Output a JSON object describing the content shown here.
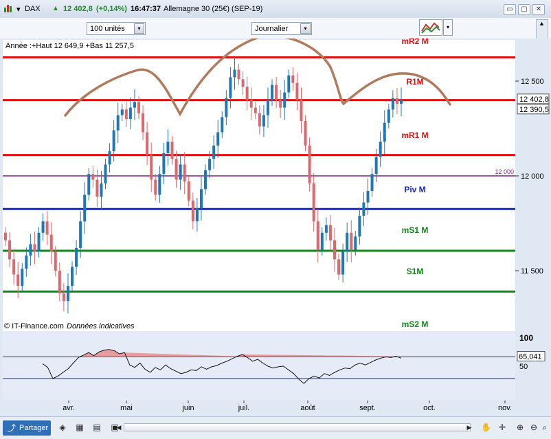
{
  "window": {
    "symbol": "DAX",
    "price": "12 402,8",
    "change": "(+0,14%)",
    "time": "16:47:37",
    "instrument": "Allemagne 30 (25€) (SEP-19)",
    "minimize": "▭",
    "restore": "▢",
    "close": "✕"
  },
  "toolbar": {
    "units_select": "100 unités",
    "period_select": "Journalier",
    "dropdown_arrow": "▾"
  },
  "colors": {
    "up": "#1f77b4",
    "down": "#d9696e",
    "resistance": "#e01010",
    "pivot": "#1428c8",
    "support": "#0a8a14",
    "guide": "#7a1e88",
    "drawing": "#b07a5c"
  },
  "footer": {
    "share_label": "Partager",
    "icons": [
      "layers-icon",
      "table-icon",
      "grid-icon",
      "window-icon",
      "clock-icon",
      "scroll-left-icon",
      "scroll-right-icon",
      "hand-icon",
      "zoom-in-icon",
      "zoom-out-icon",
      "search-icon"
    ]
  },
  "chart_data": {
    "type": "candlestick",
    "info_text": "Année :+Haut 12 649,9 +Bas 11 257,5",
    "watermark": "© IT-Finance.com",
    "watermark_note": "Données indicatives",
    "price_axis": {
      "ticks": [
        "12 500",
        "12 000",
        "11 500"
      ],
      "values": [
        12500,
        12000,
        11500
      ],
      "range": [
        11200,
        12800
      ],
      "current_price": "12 402,8",
      "last_close_label": "12 390,5",
      "guide_label": "12 000"
    },
    "x_axis_labels": [
      "avr.",
      "mai",
      "juin",
      "juil.",
      "août",
      "sept.",
      "oct.",
      "nov."
    ],
    "levels": [
      {
        "label": "mR2 M",
        "value": 12800,
        "role": "resistance",
        "drawn": false
      },
      {
        "label": "R1M",
        "value": 12625,
        "role": "resistance",
        "drawn": true
      },
      {
        "label": "mR1 M",
        "value": 12110,
        "role": "resistance",
        "drawn": true
      },
      {
        "label": "Piv M",
        "value": 11825,
        "role": "pivot",
        "drawn": true
      },
      {
        "label": "mS1 M",
        "value": 11605,
        "role": "support",
        "drawn": true
      },
      {
        "label": "S1M",
        "value": 11390,
        "role": "support",
        "drawn": true
      },
      {
        "label": "mS2 M",
        "value": 11180,
        "role": "support",
        "drawn": false
      }
    ],
    "resistance_current": 12400,
    "guide_line": 12000,
    "candles": [
      {
        "o": 11700,
        "c": 11660
      },
      {
        "o": 11660,
        "c": 11560
      },
      {
        "o": 11560,
        "c": 11480
      },
      {
        "o": 11480,
        "c": 11420
      },
      {
        "o": 11420,
        "c": 11510
      },
      {
        "o": 11510,
        "c": 11580
      },
      {
        "o": 11580,
        "c": 11640
      },
      {
        "o": 11640,
        "c": 11600
      },
      {
        "o": 11600,
        "c": 11700
      },
      {
        "o": 11700,
        "c": 11760
      },
      {
        "o": 11760,
        "c": 11690
      },
      {
        "o": 11690,
        "c": 11600
      },
      {
        "o": 11600,
        "c": 11500
      },
      {
        "o": 11500,
        "c": 11380
      },
      {
        "o": 11380,
        "c": 11340
      },
      {
        "o": 11340,
        "c": 11420
      },
      {
        "o": 11420,
        "c": 11520
      },
      {
        "o": 11520,
        "c": 11620
      },
      {
        "o": 11620,
        "c": 11760
      },
      {
        "o": 11760,
        "c": 11900
      },
      {
        "o": 11900,
        "c": 12010
      },
      {
        "o": 12010,
        "c": 11980
      },
      {
        "o": 11980,
        "c": 11890
      },
      {
        "o": 11890,
        "c": 11960
      },
      {
        "o": 11960,
        "c": 12060
      },
      {
        "o": 12060,
        "c": 12130
      },
      {
        "o": 12130,
        "c": 12240
      },
      {
        "o": 12240,
        "c": 12320
      },
      {
        "o": 12320,
        "c": 12350
      },
      {
        "o": 12350,
        "c": 12300
      },
      {
        "o": 12300,
        "c": 12360
      },
      {
        "o": 12360,
        "c": 12390
      },
      {
        "o": 12390,
        "c": 12330
      },
      {
        "o": 12330,
        "c": 12230
      },
      {
        "o": 12230,
        "c": 12110
      },
      {
        "o": 12110,
        "c": 11980
      },
      {
        "o": 11980,
        "c": 11900
      },
      {
        "o": 11900,
        "c": 12010
      },
      {
        "o": 12010,
        "c": 12120
      },
      {
        "o": 12120,
        "c": 12180
      },
      {
        "o": 12180,
        "c": 12090
      },
      {
        "o": 12090,
        "c": 11980
      },
      {
        "o": 11980,
        "c": 12060
      },
      {
        "o": 12060,
        "c": 11970
      },
      {
        "o": 11970,
        "c": 11870
      },
      {
        "o": 11870,
        "c": 11760
      },
      {
        "o": 11760,
        "c": 11830
      },
      {
        "o": 11830,
        "c": 11930
      },
      {
        "o": 11930,
        "c": 12030
      },
      {
        "o": 12030,
        "c": 12090
      },
      {
        "o": 12090,
        "c": 12160
      },
      {
        "o": 12160,
        "c": 12230
      },
      {
        "o": 12230,
        "c": 12310
      },
      {
        "o": 12310,
        "c": 12410
      },
      {
        "o": 12410,
        "c": 12520
      },
      {
        "o": 12520,
        "c": 12560
      },
      {
        "o": 12560,
        "c": 12510
      },
      {
        "o": 12510,
        "c": 12470
      },
      {
        "o": 12470,
        "c": 12400
      },
      {
        "o": 12400,
        "c": 12360
      },
      {
        "o": 12360,
        "c": 12330
      },
      {
        "o": 12330,
        "c": 12260
      },
      {
        "o": 12260,
        "c": 12320
      },
      {
        "o": 12320,
        "c": 12400
      },
      {
        "o": 12400,
        "c": 12480
      },
      {
        "o": 12480,
        "c": 12400
      },
      {
        "o": 12400,
        "c": 12360
      },
      {
        "o": 12360,
        "c": 12440
      },
      {
        "o": 12440,
        "c": 12530
      },
      {
        "o": 12530,
        "c": 12490
      },
      {
        "o": 12490,
        "c": 12400
      },
      {
        "o": 12400,
        "c": 12290
      },
      {
        "o": 12290,
        "c": 12160
      },
      {
        "o": 12160,
        "c": 11960
      },
      {
        "o": 11960,
        "c": 11760
      },
      {
        "o": 11760,
        "c": 11610
      },
      {
        "o": 11610,
        "c": 11700
      },
      {
        "o": 11700,
        "c": 11740
      },
      {
        "o": 11740,
        "c": 11660
      },
      {
        "o": 11660,
        "c": 11560
      },
      {
        "o": 11560,
        "c": 11480
      },
      {
        "o": 11480,
        "c": 11600
      },
      {
        "o": 11600,
        "c": 11700
      },
      {
        "o": 11700,
        "c": 11610
      },
      {
        "o": 11610,
        "c": 11680
      },
      {
        "o": 11680,
        "c": 11790
      },
      {
        "o": 11790,
        "c": 11860
      },
      {
        "o": 11860,
        "c": 11920
      },
      {
        "o": 11920,
        "c": 12010
      },
      {
        "o": 12010,
        "c": 12100
      },
      {
        "o": 12100,
        "c": 12180
      },
      {
        "o": 12180,
        "c": 12280
      },
      {
        "o": 12280,
        "c": 12350
      },
      {
        "o": 12350,
        "c": 12410
      },
      {
        "o": 12410,
        "c": 12380
      },
      {
        "o": 12380,
        "c": 12400
      }
    ],
    "oscillator": {
      "ticks": [
        "100",
        "50"
      ],
      "current": "65,041",
      "range": [
        0,
        100
      ],
      "upper_level": 65,
      "lower_level": 30,
      "values": [
        54,
        48,
        30,
        34,
        40,
        46,
        55,
        64,
        68,
        72,
        67,
        73,
        76,
        77,
        75,
        70,
        72,
        52,
        48,
        55,
        45,
        40,
        48,
        44,
        52,
        46,
        42,
        38,
        40,
        44,
        43,
        49,
        45,
        49,
        51,
        55,
        58,
        62,
        66,
        69,
        64,
        58,
        61,
        55,
        50,
        47,
        49,
        50,
        44,
        38,
        29,
        22,
        30,
        34,
        31,
        38,
        35,
        40,
        44,
        47,
        46,
        52,
        55,
        52,
        56,
        60,
        63,
        65,
        64,
        66,
        63
      ]
    }
  }
}
